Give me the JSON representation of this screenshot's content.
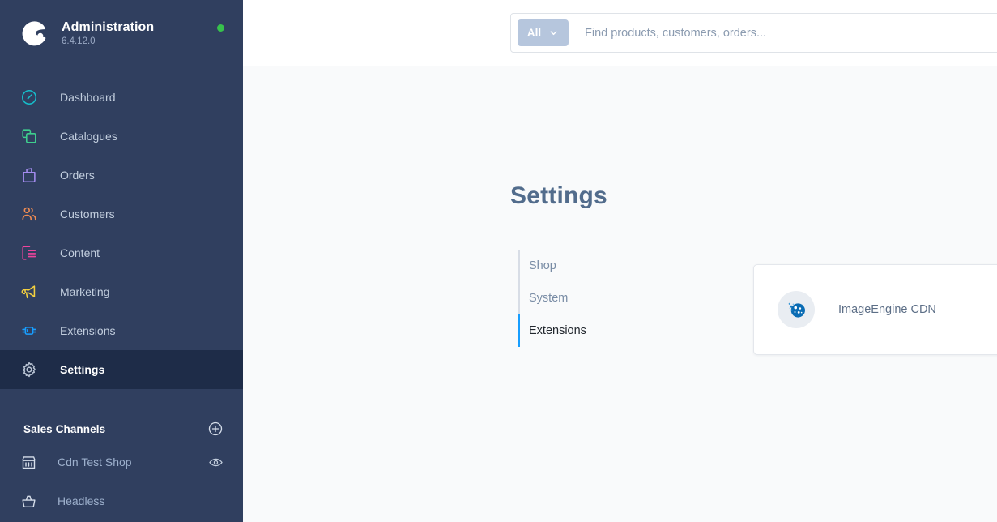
{
  "sidebar": {
    "brand": {
      "logo_icon": "shopware-logo-icon",
      "title": "Administration",
      "version": "6.4.12.0",
      "status_icon": "status-dot-online",
      "status_color": "#37c24c"
    },
    "nav_items": [
      {
        "label": "Dashboard",
        "icon": "dashboard-icon",
        "color": "#16bdca",
        "active": false
      },
      {
        "label": "Catalogues",
        "icon": "catalogues-icon",
        "color": "#3ecf8e",
        "active": false
      },
      {
        "label": "Orders",
        "icon": "orders-icon",
        "color": "#a48cf0",
        "active": false
      },
      {
        "label": "Customers",
        "icon": "customers-icon",
        "color": "#f08c52",
        "active": false
      },
      {
        "label": "Content",
        "icon": "content-icon",
        "color": "#f0449e",
        "active": false
      },
      {
        "label": "Marketing",
        "icon": "marketing-icon",
        "color": "#f4d03f",
        "active": false
      },
      {
        "label": "Extensions",
        "icon": "extensions-icon",
        "color": "#189eff",
        "active": false
      },
      {
        "label": "Settings",
        "icon": "settings-gear-icon",
        "color": "#b9c4d4",
        "active": true
      }
    ],
    "channels": {
      "title": "Sales Channels",
      "add_icon": "plus-circle-icon",
      "items": [
        {
          "label": "Cdn Test Shop",
          "icon": "storefront-icon",
          "action_icon": "eye-icon"
        },
        {
          "label": "Headless",
          "icon": "basket-icon",
          "action_icon": ""
        }
      ]
    }
  },
  "topbar": {
    "search": {
      "scope_label": "All",
      "scope_chevron_icon": "chevron-down-icon",
      "placeholder": "Find products, customers, orders...",
      "value": ""
    }
  },
  "main": {
    "page_title": "Settings",
    "tabs": [
      {
        "label": "Shop",
        "active": false
      },
      {
        "label": "System",
        "active": false
      },
      {
        "label": "Extensions",
        "active": true
      }
    ],
    "cards": [
      {
        "label": "ImageEngine CDN",
        "logo_icon": "imageengine-logo-icon"
      }
    ],
    "accent_color": "#189eff"
  }
}
